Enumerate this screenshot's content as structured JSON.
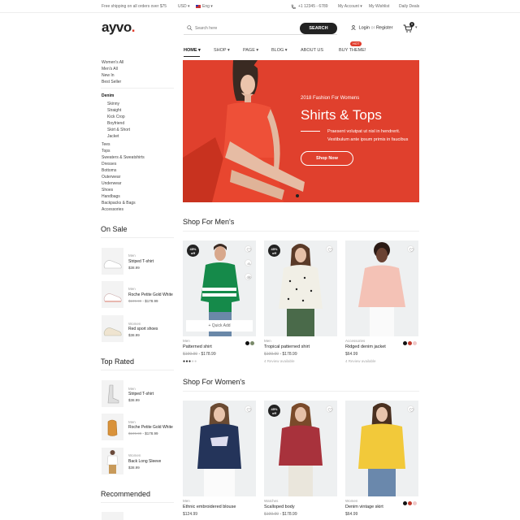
{
  "topbar": {
    "shipping": "Free shipping on all orders over $75",
    "currency": "USD ▾",
    "language": "Eng ▾",
    "phone": "+1 12345 - 6789",
    "account": "My Account ▾",
    "wishlist": "My Wishlist",
    "deals": "Daily Deals"
  },
  "header": {
    "logo": "ayvo",
    "logo_dot": ".",
    "search_placeholder": "Search here",
    "search_button": "SEARCH",
    "login": "Login",
    "or": "or",
    "register": "Register",
    "cart_count": "0"
  },
  "nav": {
    "items": [
      "HOME ▾",
      "SHOP ▾",
      "PAGE ▾",
      "BLOG ▾",
      "ABOUT US",
      "BUY THEME!"
    ],
    "hot": "HOT"
  },
  "sidebar": {
    "top_links": [
      "Women's All",
      "Men's All",
      "New In",
      "Best Seller"
    ],
    "denim": "Denim",
    "denim_items": [
      "Skinny",
      "Straight",
      "Kick Crop",
      "Boyfriend",
      "Skirt & Short",
      "Jacket"
    ],
    "categories": [
      "Tees",
      "Tops",
      "Sweaters & Sweatshirts",
      "Dresses",
      "Bottoms",
      "Outerwear",
      "Underwear",
      "Shoes",
      "Handbags",
      "Backpacks & Bags",
      "Accessories"
    ],
    "on_sale": {
      "title": "On Sale",
      "items": [
        {
          "cat": "Men",
          "name": "Striped T-shirt",
          "old": "",
          "price": "$38.99"
        },
        {
          "cat": "Men",
          "name": "Roche Petite Gold White",
          "old": "$199.99",
          "price": "$178.99"
        },
        {
          "cat": "Women",
          "name": "Red sport shoes",
          "old": "",
          "price": "$38.99"
        }
      ]
    },
    "top_rated": {
      "title": "Top Rated",
      "items": [
        {
          "cat": "Men",
          "name": "Striped T-shirt",
          "old": "",
          "price": "$38.99"
        },
        {
          "cat": "Men",
          "name": "Roche Petite Gold White",
          "old": "$199.99",
          "price": "$178.99"
        },
        {
          "cat": "Women",
          "name": "Back Long Sleeve",
          "old": "",
          "price": "$38.99"
        }
      ]
    },
    "recommended": {
      "title": "Recommended"
    }
  },
  "hero": {
    "subtitle": "2018 Fashion For Womens",
    "title": "Shirts & Tops",
    "desc1": "Praesent volutpat ut nisl in hendrerit.",
    "desc2": "Vestibulum ante ipsum primis in faucibus",
    "button": "Shop Now"
  },
  "men_section": {
    "title": "Shop For Men's",
    "products": [
      {
        "badge_pct": "45%",
        "badge_off": "off",
        "cat": "Men",
        "name": "Patterned shirt",
        "old": "$199.99",
        "price": "$178.99",
        "rating": 3,
        "quick_add": "+ Quick Add",
        "swatches": [
          "#111111",
          "#7a8a6a"
        ]
      },
      {
        "badge_pct": "45%",
        "badge_off": "off",
        "cat": "Men",
        "name": "Tropical patterned shirt",
        "old": "$199.99",
        "price": "$178.99",
        "review": "4 Review available"
      },
      {
        "cat": "Accessories",
        "name": "Ridged denim jacket",
        "price": "$64.99",
        "review": "4 Review available",
        "swatches": [
          "#111111",
          "#c0392b",
          "#f0c8c8"
        ]
      }
    ]
  },
  "women_section": {
    "title": "Shop For Women's",
    "products": [
      {
        "cat": "Men",
        "name": "Ethnic embroidered blouse",
        "price": "$124.99"
      },
      {
        "badge_pct": "45%",
        "badge_off": "off",
        "cat": "Watches",
        "name": "Scalloped body",
        "old": "$199.99",
        "price": "$178.99"
      },
      {
        "cat": "Women",
        "name": "Denim vintage skirt",
        "price": "$64.99",
        "swatches": [
          "#111111",
          "#c0392b",
          "#f0c8c8"
        ]
      }
    ]
  },
  "colors": {
    "accent": "#e0402d",
    "dark": "#222222"
  }
}
